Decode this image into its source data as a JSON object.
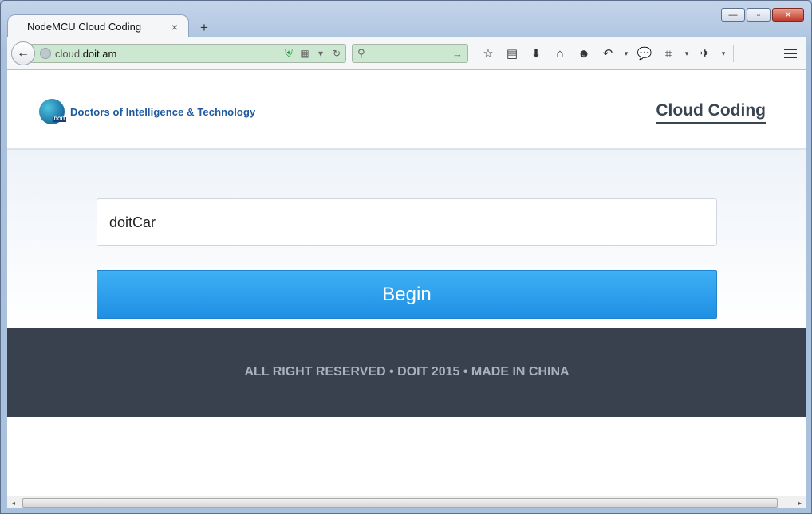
{
  "browser": {
    "tab_title": "NodeMCU Cloud Coding",
    "tab_close": "×",
    "new_tab": "+",
    "url_prefix": "cloud.",
    "url_domain": "doit.am",
    "back": "←",
    "search_go": "→",
    "search_icon": "magnifier-icon",
    "window_minimize": "—",
    "window_maximize": "▫",
    "window_close": "✕",
    "toolbar_icons": [
      "star-icon",
      "reading-list-icon",
      "download-icon",
      "home-icon",
      "smiley-icon",
      "undo-icon",
      "chat-icon",
      "crop-icon",
      "extension-icon",
      "menu-icon"
    ],
    "glyphs": {
      "star": "☆",
      "list": "▤",
      "download": "⬇",
      "home": "⌂",
      "smiley": "☻",
      "undo": "↶",
      "chat": "💬",
      "crop": "⌗",
      "ext": "✈",
      "drop": "▾",
      "shield": "⛨",
      "qr": "▦",
      "reload": "↻",
      "scroll_left": "◂",
      "scroll_right": "▸",
      "grip": "⦙"
    }
  },
  "site": {
    "logo_text": "Doctors of Intelligence & Technology",
    "logo_sub": "DOIT",
    "nav_link": "Cloud Coding",
    "input_value": "doitCar",
    "begin_button": "Begin",
    "footer": "ALL RIGHT RESERVED • DOIT 2015 • MADE IN CHINA"
  },
  "colors": {
    "accent_button": "#2a9ff0",
    "footer_bg": "#38414d",
    "url_bar_bg": "#cde8d0",
    "logo_text": "#1f5aa0"
  }
}
